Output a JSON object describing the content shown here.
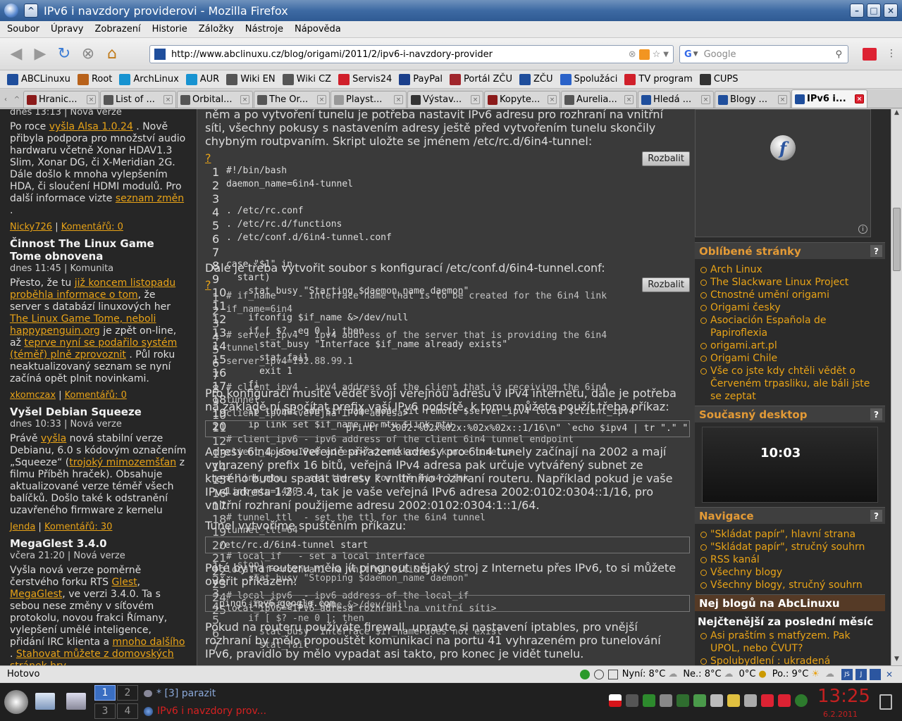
{
  "window": {
    "title": "IPv6 i navzdory providerovi - Mozilla Firefox"
  },
  "menu": [
    "Soubor",
    "Úpravy",
    "Zobrazení",
    "Historie",
    "Záložky",
    "Nástroje",
    "Nápověda"
  ],
  "url": "http://www.abclinuxu.cz/blog/origami/2011/2/ipv6-i-navzdory-provider",
  "search": {
    "engine": "G",
    "placeholder": "Google"
  },
  "bookmarks": [
    {
      "label": "ABCLinuxu",
      "icon": "abclinuxu-icon",
      "color": "#1f4e9c"
    },
    {
      "label": "Root",
      "icon": "root-icon",
      "color": "#b8621b"
    },
    {
      "label": "ArchLinux",
      "icon": "archlinux-icon",
      "color": "#1793d1"
    },
    {
      "label": "AUR",
      "icon": "aur-icon",
      "color": "#1793d1"
    },
    {
      "label": "Wiki EN",
      "icon": "wikipedia-icon",
      "color": "#555555"
    },
    {
      "label": "Wiki CZ",
      "icon": "wikipedia-icon",
      "color": "#555555"
    },
    {
      "label": "Servis24",
      "icon": "servis24-icon",
      "color": "#d01f2a"
    },
    {
      "label": "PayPal",
      "icon": "paypal-icon",
      "color": "#1b3f8b"
    },
    {
      "label": "Portál ZČU",
      "icon": "zcu-portal-icon",
      "color": "#a0262c"
    },
    {
      "label": "ZČU",
      "icon": "zcu-icon",
      "color": "#1f4e9c"
    },
    {
      "label": "Spolužáci",
      "icon": "spoluzaci-icon",
      "color": "#2a62c9"
    },
    {
      "label": "TV program",
      "icon": "tv-icon",
      "color": "#d01f2a"
    },
    {
      "label": "CUPS",
      "icon": "cups-icon",
      "color": "#333333"
    }
  ],
  "tabs": [
    {
      "label": "Hranic...",
      "color": "#8b1a1a"
    },
    {
      "label": "List of ...",
      "color": "#555555"
    },
    {
      "label": "Orbital...",
      "color": "#555555"
    },
    {
      "label": "The Or...",
      "color": "#555555"
    },
    {
      "label": "Playst...",
      "color": "#999999"
    },
    {
      "label": "Výstav...",
      "color": "#333333"
    },
    {
      "label": "Kopyte...",
      "color": "#8b1a1a"
    },
    {
      "label": "Aurelia...",
      "color": "#555555"
    },
    {
      "label": "Hledá ...",
      "color": "#1f4e9c"
    },
    {
      "label": "Blogy ...",
      "color": "#1f4e9c"
    },
    {
      "label": "IPv6 i...",
      "color": "#1f4e9c",
      "active": true
    }
  ],
  "left": {
    "top_meta": "dnes 13:13 | Nová verze",
    "news": [
      {
        "title": "",
        "meta": "",
        "text": [
          "Po roce ",
          {
            "l": "vyšla Alsa 1.0.24"
          },
          " . Nově přibyla podpora pro množství audio hardwaru včetně Xonar HDAV1.3 Slim, Xonar DG, či X-Meridian 2G. Dále došlo k mnoha vylepšením HDA, či sloučení HDMI modulů. Pro další informace vizte ",
          {
            "l": "seznam změn"
          },
          " ."
        ],
        "author": "Nicky726",
        "comments": "Komentářů: 0"
      },
      {
        "title": "Činnost The Linux Game Tome obnovena",
        "meta": "dnes 11:45 | Komunita",
        "text": [
          "Přesto, že tu ",
          {
            "l": "již koncem listopadu proběhla informace o tom"
          },
          ", že server s databází linuxových her ",
          {
            "l": "The Linux Game Tome, neboli happypenguin.org"
          },
          " je zpět on-line, až ",
          {
            "l": "teprve nyní se podařilo systém (téměř) plně zprovoznit"
          },
          " . Půl roku neaktualizovaný seznam se nyní začíná opět plnit novinkami."
        ],
        "author": "xkomczax",
        "comments": "Komentářů: 0"
      },
      {
        "title": "Vyšel Debian Squeeze",
        "meta": "dnes 10:33 | Nová verze",
        "text": [
          "Právě ",
          {
            "l": "vyšla"
          },
          " nová stabilní verze Debianu, 6.0 s kódovým označením „Squeeze“ (",
          {
            "l": "trojoký mimozemšťan"
          },
          " z filmu Příběh hraček). Obsahuje aktualizované verze téměř všech balíčků. Došlo také k odstranění uzavřeného firmware z kernelu"
        ],
        "author": "Jenda",
        "comments": "Komentářů: 30"
      },
      {
        "title": "MegaGlest 3.4.0",
        "meta": "včera 21:20 | Nová verze",
        "text": [
          "Vyšla nová verze poměrně čerstvého forku RTS ",
          {
            "l": "Glest"
          },
          ", ",
          {
            "l": "MegaGlest"
          },
          ", ve verzi 3.4.0. Ta s sebou nese změny v síťovém protokolu, novou frakci Římany, vylepšení umělé inteligence, přidání IRC klienta a ",
          {
            "l": "mnoho dalšího"
          },
          " . ",
          {
            "l": "Stahovat můžete z domovských stránek hry"
          },
          " ."
        ],
        "author": "",
        "comments": ""
      }
    ]
  },
  "article": {
    "p1": "něm a po vytvoření tunelu je potřeba nastavit IPv6 adresu pro rozhraní na vnitřní síti, všechny pokusy s nastavením adresy ještě před vytvořením tunelu skončily chybným routpvaním. Skript uložte se jménem /etc/rc.d/6in4-tunnel:",
    "expand": "Rozbalit",
    "q": "?",
    "code1": [
      "#!/bin/bash",
      "daemon_name=6in4-tunnel",
      "",
      ". /etc/rc.conf",
      ". /etc/rc.d/functions",
      ". /etc/conf.d/6in4-tunnel.conf",
      "",
      "case \"$1\" in",
      "  start)",
      "    stat_busy \"Starting $daemon_name daemon\"",
      "",
      "    ifconfig $if_name &>/dev/null",
      "    if [ $? -eq 0 ]; then",
      "      stat_busy \"Interface $if_name already exists\"",
      "      stat_fail",
      "      exit 1",
      "    fi",
      "",
      "    ip tunnel add $if_name mode sit remote $server_ipv4 local $client_ipv4",
      "    ip link set $if_name up mtu $link_mtu"
    ],
    "p2": "Dále je třeba vytvořit soubor s konfigurací /etc/conf.d/6in4-tunnel.conf:",
    "code2": [
      "# if_name    - interface name that is to be created for the 6in4 link",
      "if_name=6in4",
      "",
      "# server_ipv4 - ipv4 address of the server that is providing the 6in4",
      "tunnel",
      "server_ipv4=192.88.99.1",
      "",
      "# client_ipv4 - ipv4 address of the client that is receiving the 6in4",
      "tunnel",
      "client_ipv4=<veřejná IPv4 adresa>",
      "",
      "# client_ipv6 - ipv6 address of the client 6in4 tunnel endpoint",
      "client_ipv6=<IPv6 adresa>/<lentkkování konce tunelu>",
      "",
      "# link_mtu   - set the mtu for the 6in4 link",
      "link_mtu=1480",
      "",
      "# tunnel_ttl  - set the ttl for the 6in4 tunnel",
      "tunnel_ttl=64",
      "",
      "# local_if   - set a local interface",
      "local_if=<rozhraní na vnitřní síti&tg;",
      "",
      "# local_ipv6  - ipv6 address of the local_if",
      "local_ipv6=<IPv6 adresa rozhraní na vnitřní síti>"
    ],
    "p3": "Pro konfiguraci musíte vědět svojí veřejnou adresu v IPv4 internetu, dále je potřeba na základě ní spočítat prefix vaší IPv6 podsítě, k tomu můžete použít třeba příkaz:",
    "cmd1": "printf \"2002:%02x%02x:%02x%02x::1/16\\n\" `echo $ipv4 | tr \".\" \" \"`",
    "p4": "Adresy 6in4 jsou veřejně přiřazené adresy pro 6in4 tunely začínají na 2002 a mají vyhrazený prefix 16 bitů, veřejná IPv4 adresa pak určuje vytvářený subnet ze kterého budou spadat adresy k vnitřního rozhraní routeru. Například pokud je vaše IPv4 adresa 1.2.3.4, tak je vaše veřejná IPv6 adresa 2002:0102:0304::1/16, pro vnitřní rozhraní použijeme adresu 2002:0102:0304:1::1/64.",
    "p5": "Tunel vytvoříme spuštěním příkazu:",
    "cmd2": "/etc/rc.d/6in4-tunnel start",
    "p6": "Poté by na routeru mělo jít pingnout nějaký stroj z Internetu přes IPv6, to si můžete ověřit příkazem:",
    "cmd3": "ping6 ipv6.google.com",
    "p7": "Pokud na routeru používáte firewall, upravte si nastavení iptables, pro vnější rozhraní by mělo propouštět komunikaci na portu 41 vyhrazeném pro tunelování IPv6, pravidlo by mělo vypadat asi takto, pro konec je vidět tunelu.",
    "code3": [
      "  stop)",
      "    stat_busy \"Stopping $daemon_name daemon\"",
      "",
      "    ifconfig $if_name &>/dev/null",
      "    if [ $? -ne 0 ]; then",
      "      stat_busy \"Interface $if_name does not exist\"",
      "      stat_fail"
    ]
  },
  "right": {
    "fav_title": "Oblíbené stránky",
    "fav": [
      "Arch Linux",
      "The Slackware Linux Project",
      "Ctnostné umění origami",
      "Origami česky",
      "Asociación Española de Papiroflexia",
      "origami.art.pl",
      "Origami Chile",
      "Vše co jste kdy chtěli vědět o Červeném trpasliku, ale báli jste se zeptat"
    ],
    "desk_title": "Současný desktop",
    "clock": "10:03",
    "nav_title": "Navigace",
    "nav": [
      "\"Skládat papír\", hlavní strana",
      "\"Skládat papír\", stručný souhrn",
      "RSS kanál",
      "Všechny blogy",
      "Všechny blogy, stručný souhrn"
    ],
    "nej_title": "Nej blogů na AbcLinuxu",
    "nej_sub": "Nejčtenější za poslední měsíc",
    "nej": [
      "Asi praštím s matfyzem. Pak UPOL, nebo ČVUT?",
      "Spolubydlení : ukradená"
    ],
    "q": "?"
  },
  "status": {
    "text": "Hotovo",
    "now": "Nyní: 8°C",
    "sun": "Ne.: 8°C",
    "zero": "0°C",
    "mon": "Po.: 9°C"
  },
  "taskbar": {
    "pager": [
      "1",
      "2",
      "3",
      "4"
    ],
    "task1": "* [3] parazit",
    "task2": "IPv6 i navzdory prov...",
    "time": "13:25",
    "date": "6.2.2011"
  }
}
